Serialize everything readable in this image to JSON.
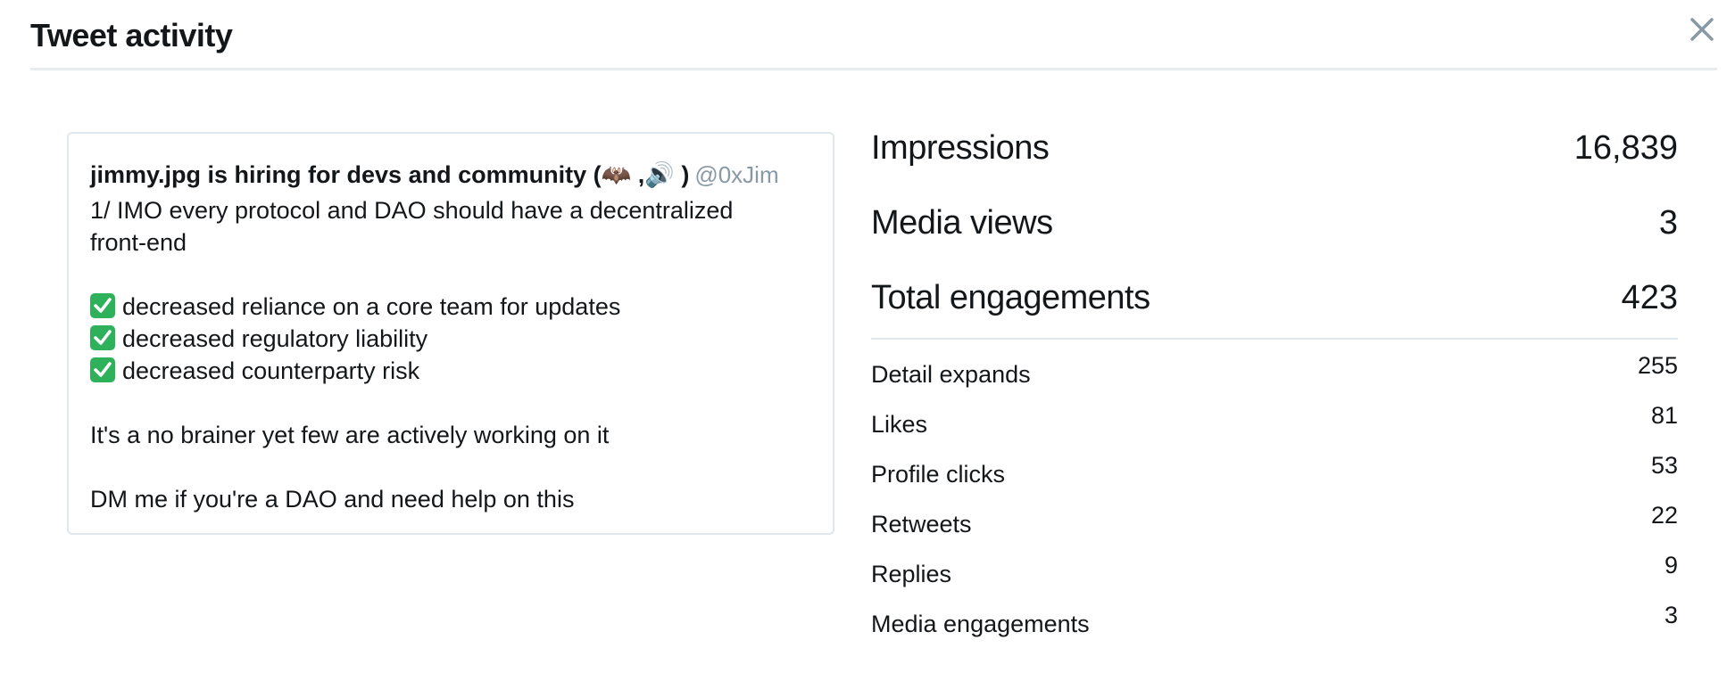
{
  "modal": {
    "title": "Tweet activity",
    "close_icon": "close-icon"
  },
  "tweet": {
    "author": "jimmy.jpg is hiring for devs and community (🦇 ,🔊 )",
    "handle": "@0xJim",
    "lines": [
      "1/ IMO every protocol and DAO should have a decentralized",
      "front-end",
      "",
      "decreased reliance on a core team for updates",
      "decreased regulatory liability",
      "decreased counterparty risk",
      "",
      "It's a no brainer yet few are actively working on it",
      "",
      "DM me if you're a DAO and need help on this"
    ],
    "check_icon": "check-mark-button-icon",
    "check_color": "#2fb15c"
  },
  "stats": {
    "primary": [
      {
        "label": "Impressions",
        "value": "16,839"
      },
      {
        "label": "Media views",
        "value": "3"
      },
      {
        "label": "Total engagements",
        "value": "423"
      }
    ],
    "breakdown": [
      {
        "label": "Detail expands",
        "value": "255"
      },
      {
        "label": "Likes",
        "value": "81"
      },
      {
        "label": "Profile clicks",
        "value": "53"
      },
      {
        "label": "Retweets",
        "value": "22"
      },
      {
        "label": "Replies",
        "value": "9"
      },
      {
        "label": "Media engagements",
        "value": "3"
      }
    ]
  },
  "colors": {
    "text": "#14171a",
    "muted": "#8899a6",
    "border": "#e1e8ed"
  }
}
